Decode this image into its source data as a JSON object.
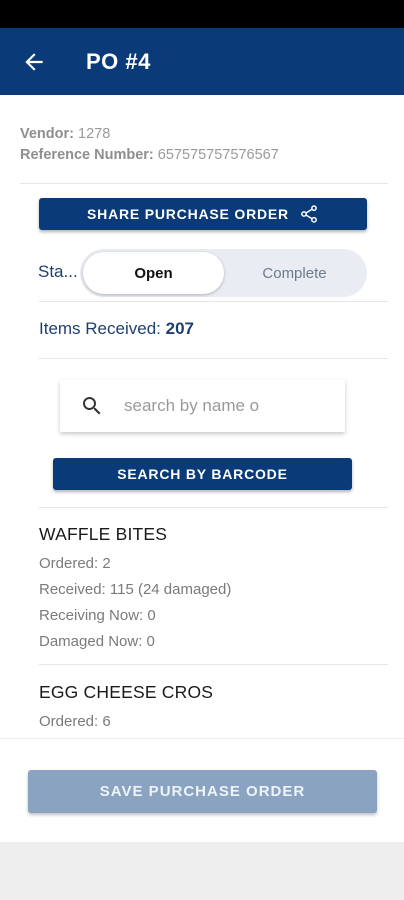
{
  "app_bar": {
    "title": "PO #4"
  },
  "vendor": {
    "vendor_label": "Vendor:",
    "vendor_value": "1278",
    "reference_label": "Reference Number:",
    "reference_value": "657575757576567"
  },
  "share_button": {
    "label": "SHARE PURCHASE ORDER"
  },
  "status": {
    "label": "Sta...",
    "options": [
      "Open",
      "Complete"
    ],
    "selected": "Open"
  },
  "items_received": {
    "label": "Items Received:",
    "value": "207"
  },
  "search": {
    "placeholder": "search by name o"
  },
  "barcode_button": {
    "label": "SEARCH BY BARCODE"
  },
  "items": [
    {
      "name": "WAFFLE BITES",
      "ordered": "Ordered: 2",
      "received": "Received: 115 (24 damaged)",
      "receiving_now": "Receiving Now: 0",
      "damaged_now": "Damaged Now: 0"
    },
    {
      "name": "EGG CHEESE CROS",
      "ordered": "Ordered: 6"
    }
  ],
  "save_button": {
    "label": "SAVE PURCHASE ORDER"
  },
  "colors": {
    "primary": "#0b3a78",
    "disabled_button": "#8aa3c0",
    "label_text": "#1f3f70"
  }
}
